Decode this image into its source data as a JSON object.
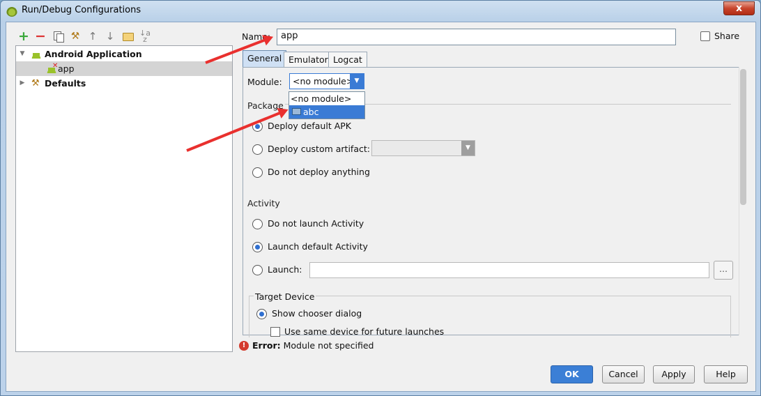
{
  "window": {
    "title": "Run/Debug Configurations",
    "close_glyph": "x"
  },
  "toolbar": {
    "add_glyph": "+",
    "remove_glyph": "−",
    "wrench_glyph": "⚒",
    "up_glyph": "↑",
    "down_glyph": "↓",
    "sort_glyph": "↓a z"
  },
  "tree": {
    "items": [
      {
        "label": "Android Application",
        "expanded": true,
        "bold": true
      },
      {
        "label": "app",
        "selected": true
      },
      {
        "label": "Defaults",
        "expanded": false,
        "bold": true
      }
    ],
    "expanded_arrow": "▼",
    "collapsed_arrow": "▶"
  },
  "form": {
    "name_label": "Name:",
    "name_value": "app",
    "share_label": "Share",
    "tabs": [
      "General",
      "Emulator",
      "Logcat"
    ],
    "active_tab": "General",
    "module_label": "Module:",
    "module_value": "<no module>",
    "module_options": [
      "<no module>",
      "abc"
    ],
    "module_highlighted": "abc",
    "package_label": "Package",
    "package_options": [
      "Deploy default APK",
      "Deploy custom artifact:",
      "Do not deploy anything"
    ],
    "package_selected": "Deploy default APK",
    "activity_label": "Activity",
    "activity_options": [
      "Do not launch Activity",
      "Launch default Activity",
      "Launch:"
    ],
    "activity_selected": "Launch default Activity",
    "launch_value": "",
    "browse_label": "...",
    "target_label": "Target Device",
    "target_options": [
      "Show chooser dialog"
    ],
    "same_device_label": "Use same device for future launches"
  },
  "error": {
    "icon": "!",
    "prefix": "Error:",
    "message": "Module not specified"
  },
  "buttons": {
    "ok": "OK",
    "cancel": "Cancel",
    "apply": "Apply",
    "help": "Help"
  },
  "colors": {
    "accent": "#3b7fd6",
    "annotation": "#e9302e",
    "error": "#d43b2e"
  }
}
